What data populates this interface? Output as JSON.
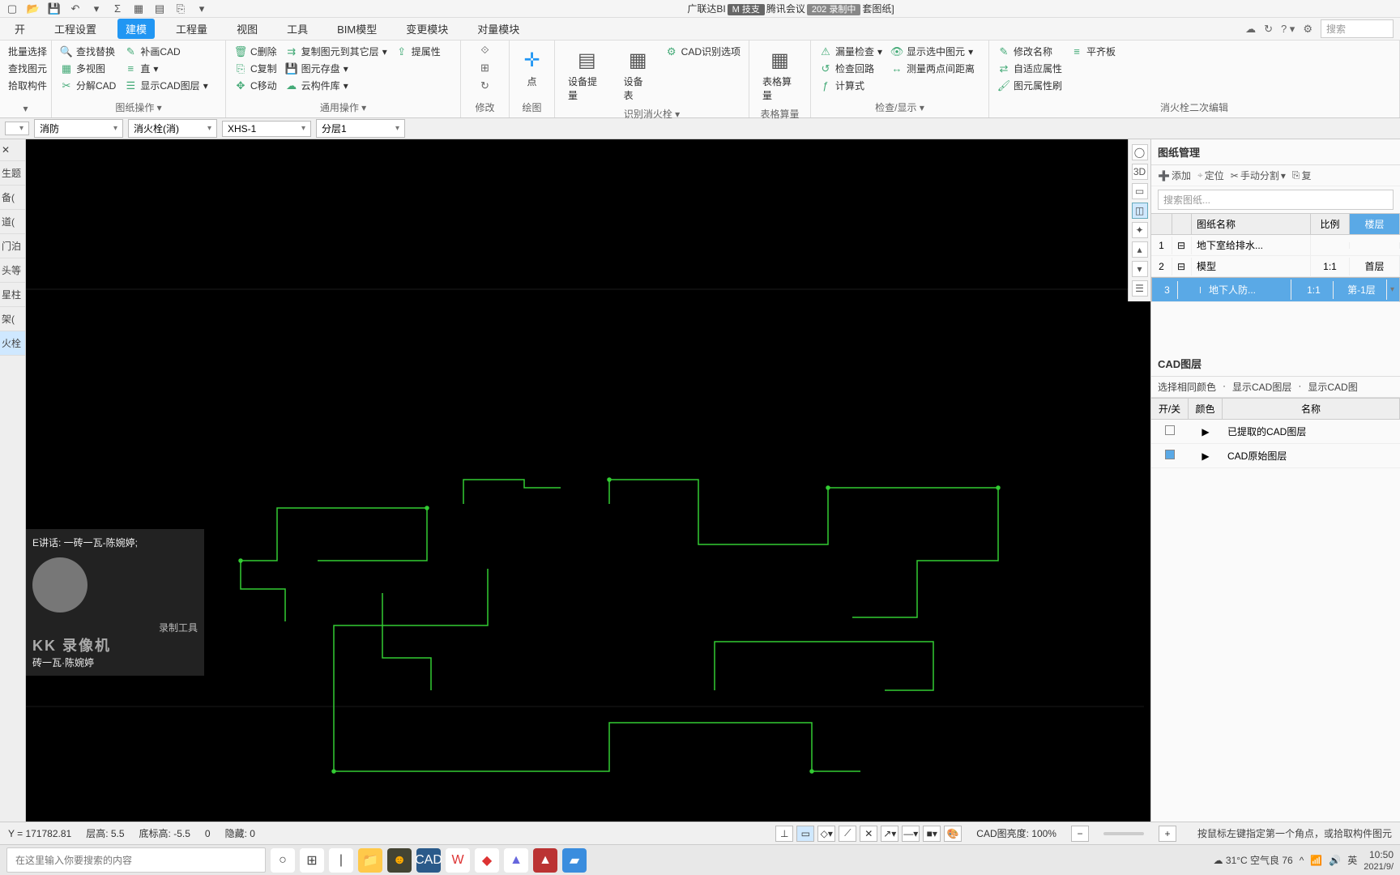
{
  "title": {
    "prefix": "广联达BI",
    "badge1": "M 技支",
    "mid": "腾讯会议",
    "badge2": "202 录制中",
    "suffix": "套图纸]"
  },
  "mainTabs": {
    "t0": "开",
    "t1": "工程设置",
    "t2": "建模",
    "t3": "工程量",
    "t4": "视图",
    "t5": "工具",
    "t6": "BIM模型",
    "t7": "变更模块",
    "t8": "对量模块"
  },
  "searchPlaceholder": "搜索",
  "ribbon": {
    "g1": {
      "a": "批量选择",
      "b": "查找图元",
      "c": "拾取构件"
    },
    "g2": {
      "a": "查找替换",
      "b": "多视图",
      "c": "分解CAD",
      "d": "补画CAD",
      "e": "直",
      "f": "显示CAD图层"
    },
    "g2_label": "图纸操作",
    "g3": {
      "a": "C删除",
      "b": "C复制",
      "c": "C移动",
      "d": "复制图元到其它层",
      "e": "图元存盘",
      "f": "云构件库",
      "g": "提属性"
    },
    "g3_label": "通用操作",
    "g4": {
      "label": "修改"
    },
    "g5": {
      "big": "点",
      "label": "绘图"
    },
    "g6": {
      "a": "设备提量",
      "b": "设备表",
      "c": "CAD识别选项",
      "label": "识别消火栓"
    },
    "g7": {
      "big": "表格算量",
      "label": "表格算量"
    },
    "g8": {
      "a": "漏量检查",
      "b": "检查回路",
      "c": "计算式",
      "d": "显示选中图元",
      "e": "测量两点间距离",
      "label": "检查/显示"
    },
    "g9": {
      "a": "修改名称",
      "b": "自适应属性",
      "c": "图元属性刷",
      "d": "平齐板",
      "label": "消火栓二次编辑"
    }
  },
  "selectors": {
    "s0": "",
    "s1": "消防",
    "s2": "消火栓(消)",
    "s3": "XHS-1",
    "s4": "分层1"
  },
  "leftItems": [
    "生题",
    "备(",
    "道(",
    "门泊",
    "头等",
    "星柱",
    "架("
  ],
  "leftActive": "火栓",
  "rightPanel": {
    "header": "图纸管理",
    "tools": {
      "add": "添加",
      "locate": "定位",
      "split": "手动分割",
      "copy": "复"
    },
    "searchPlaceholder": "搜索图纸...",
    "cols": {
      "name": "图纸名称",
      "scale": "比例",
      "floor": "楼层"
    },
    "rows": [
      {
        "idx": "1",
        "name": "地下室给排水...",
        "scale": "",
        "floor": ""
      },
      {
        "idx": "2",
        "name": "模型",
        "scale": "1:1",
        "floor": "首层"
      },
      {
        "idx": "3",
        "name": "地下人防...",
        "scale": "1:1",
        "floor": "第-1层"
      }
    ],
    "cadHeader": "CAD图层",
    "cadFilters": {
      "a": "选择相同颜色",
      "b": "显示CAD图层",
      "c": "显示CAD图"
    },
    "layerCols": {
      "on": "开/关",
      "color": "颜色",
      "name": "名称"
    },
    "layers": [
      {
        "on": false,
        "name": "已提取的CAD图层"
      },
      {
        "on": true,
        "name": "CAD原始图层"
      }
    ]
  },
  "overlay": {
    "speaker": "E讲话: 一砖一瓦-陈婉婷;",
    "tool": "录制工具",
    "wm": "KK 录像机",
    "name": "砖一瓦·陈婉婷"
  },
  "status": {
    "coord": "Y = 171782.81",
    "h": "层高: 5.5",
    "bh": "底标高: -5.5",
    "zero": "0",
    "hidden": "隐藏: 0",
    "bright": "CAD图亮度: 100%",
    "hint": "按鼠标左键指定第一个角点，或拾取构件图元"
  },
  "taskbar": {
    "search": "在这里输入你要搜索的内容",
    "weather": "31°C 空气良 76",
    "ime": "英",
    "time": "10:50",
    "date": "2021/9/"
  }
}
